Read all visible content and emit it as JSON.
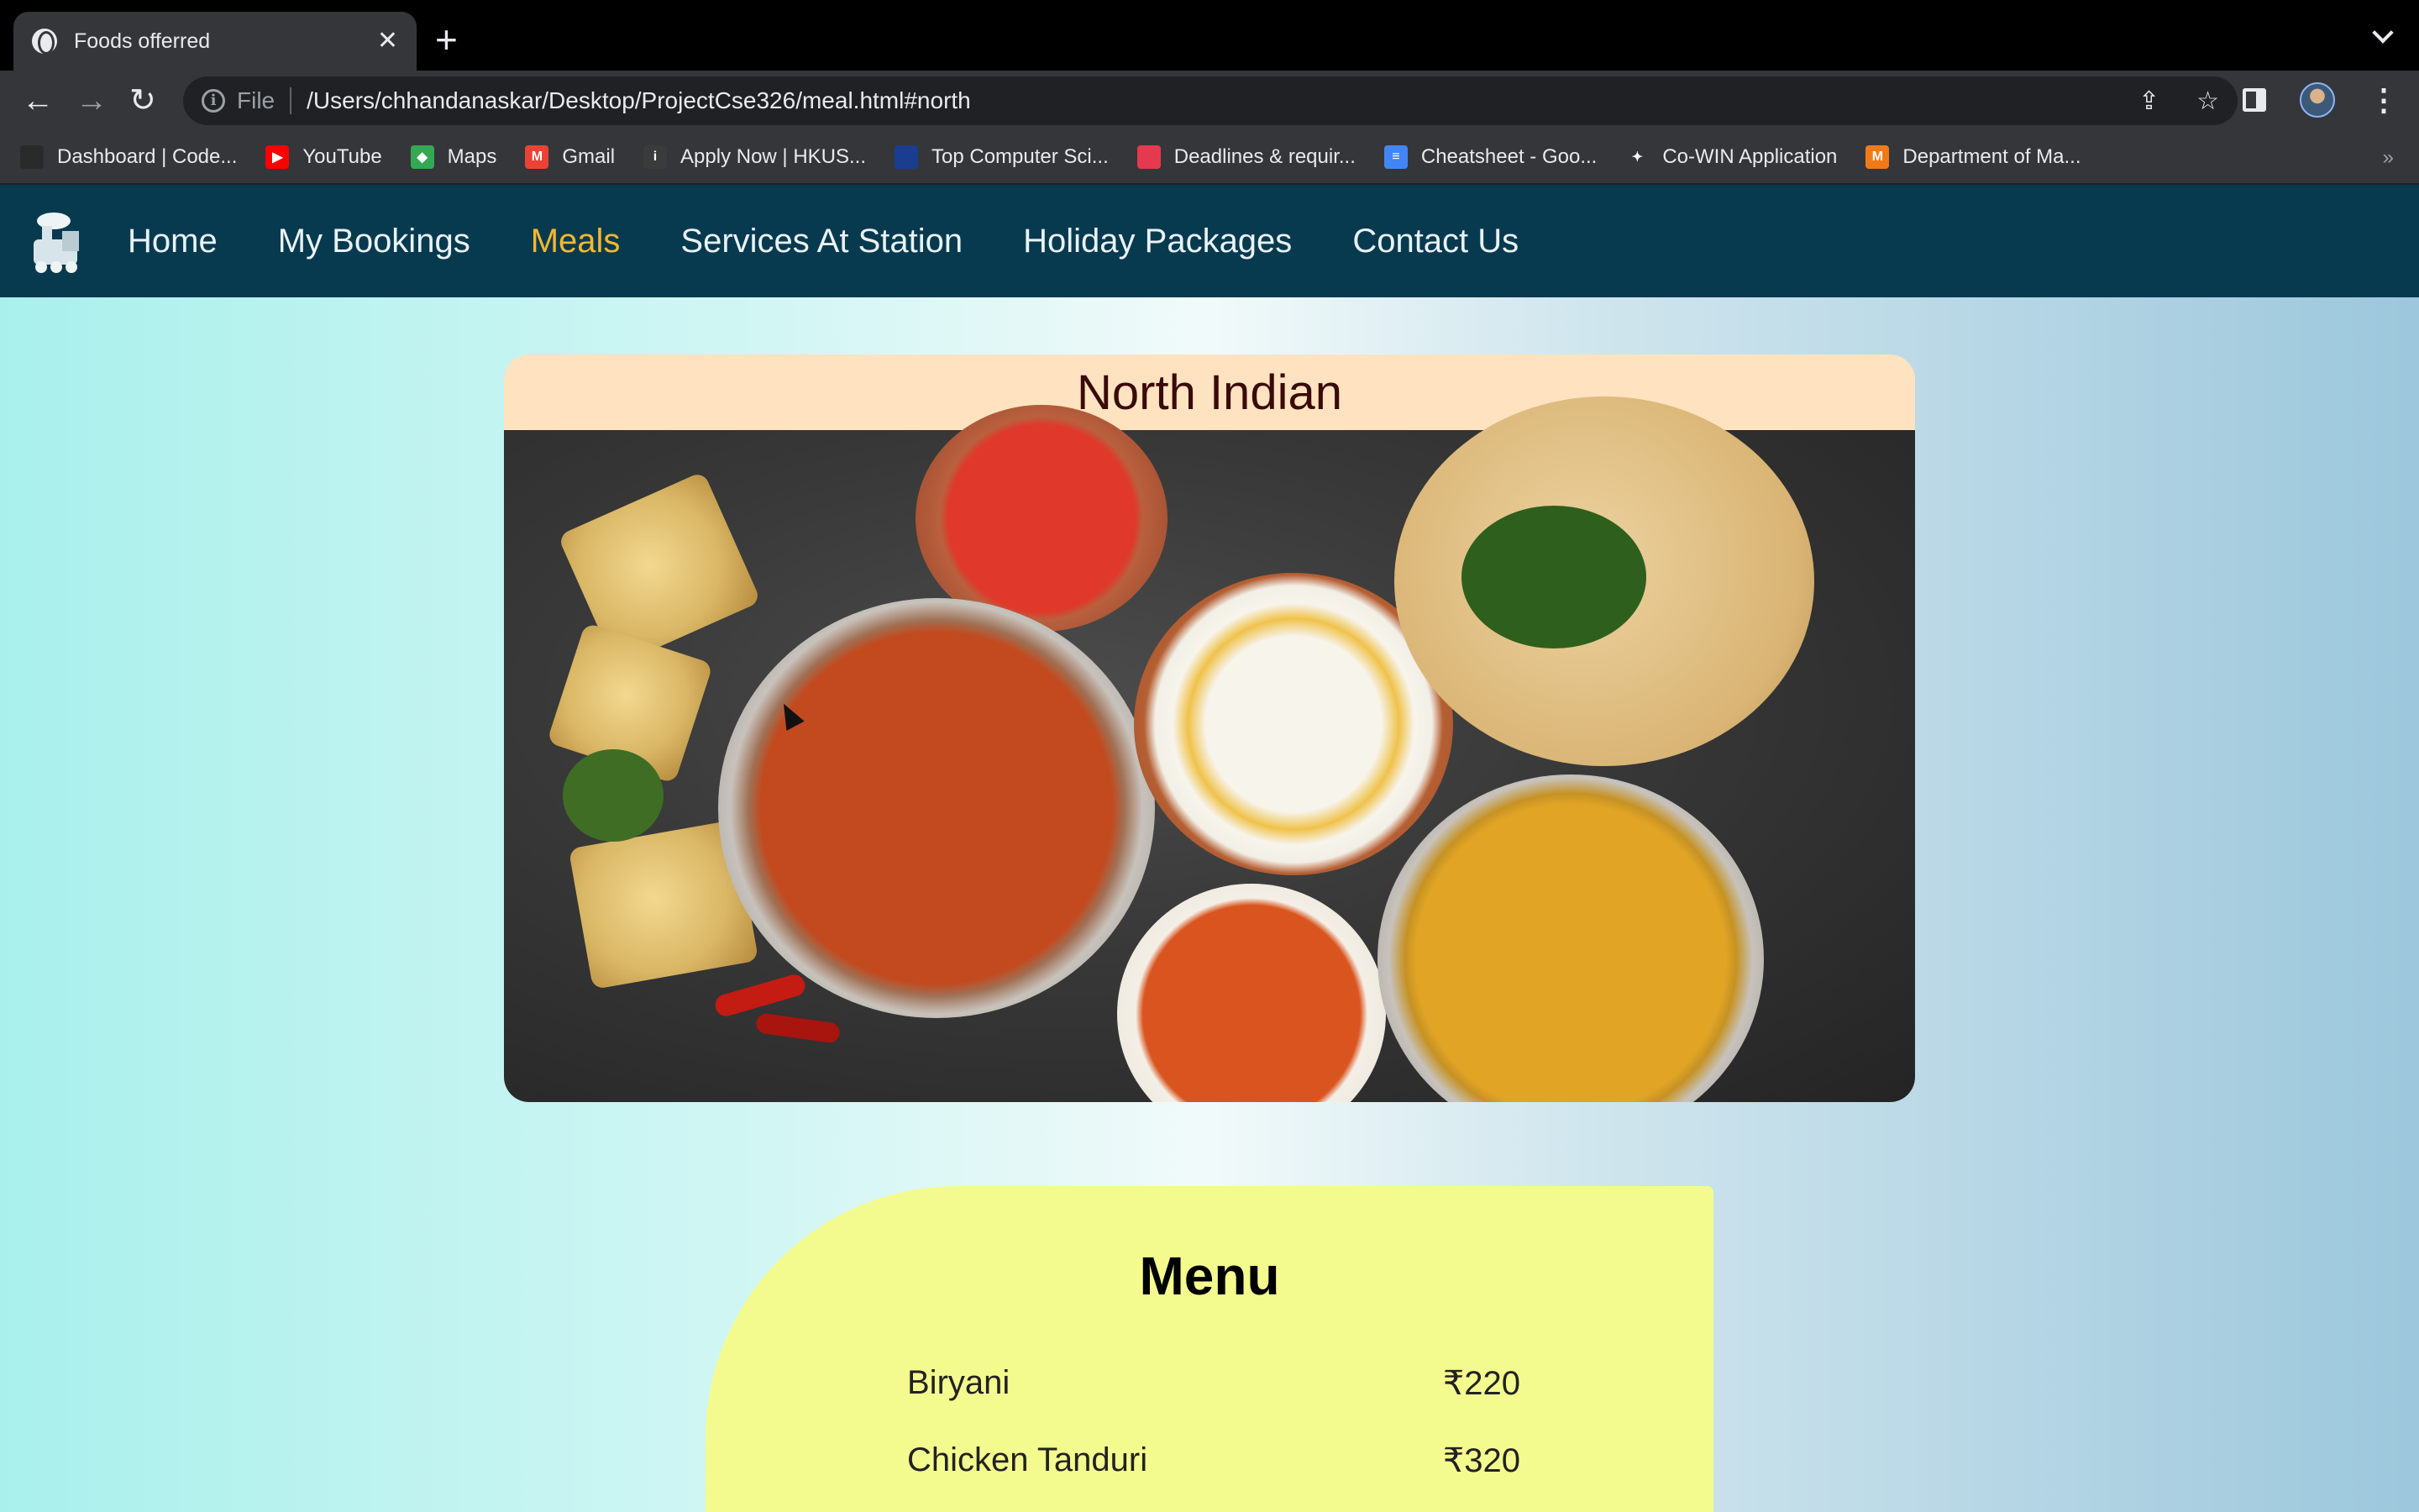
{
  "browser": {
    "tab_title": "Foods offerred",
    "url_scheme_label": "File",
    "url": "/Users/chhandanaskar/Desktop/ProjectCse326/meal.html#north",
    "bookmarks": [
      {
        "label": "Dashboard | Code...",
        "color": "#2a2a2a"
      },
      {
        "label": "YouTube",
        "color": "#ff0000"
      },
      {
        "label": "Maps",
        "color": "#34a853"
      },
      {
        "label": "Gmail",
        "color": "#ea4335"
      },
      {
        "label": "Apply Now | HKUS...",
        "color": "#3b3b3b"
      },
      {
        "label": "Top Computer Sci...",
        "color": "#1a3d8f"
      },
      {
        "label": "Deadlines & requir...",
        "color": "#e53950"
      },
      {
        "label": "Cheatsheet - Goo...",
        "color": "#4285f4"
      },
      {
        "label": "Co-WIN Application",
        "color": "#35363a"
      },
      {
        "label": "Department of Ma...",
        "color": "#f07a1a"
      }
    ]
  },
  "site": {
    "nav": [
      {
        "label": "Home",
        "active": false
      },
      {
        "label": "My Bookings",
        "active": false
      },
      {
        "label": "Meals",
        "active": true
      },
      {
        "label": "Services At Station",
        "active": false
      },
      {
        "label": "Holiday Packages",
        "active": false
      },
      {
        "label": "Contact Us",
        "active": false
      }
    ],
    "section_title": "North Indian",
    "menu": {
      "title": "Menu",
      "items": [
        {
          "name": "Biryani",
          "price": "₹220"
        },
        {
          "name": "Chicken Tanduri",
          "price": "₹320"
        }
      ]
    }
  },
  "colors": {
    "nav_bg": "#083a4f",
    "nav_active": "#f5b731",
    "title_band": "#ffe3c0",
    "menu_card": "#f4fb8e"
  }
}
